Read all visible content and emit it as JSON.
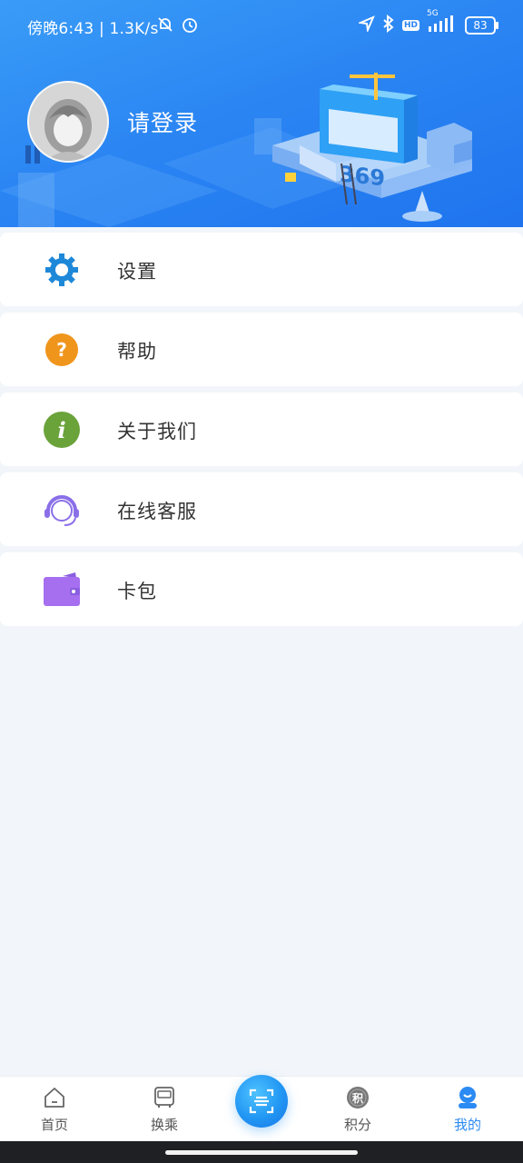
{
  "status_bar": {
    "time_text": "傍晚6:43",
    "speed_text": "1.3K/s",
    "network": "5G",
    "hd_label": "HD",
    "battery": "83"
  },
  "profile": {
    "login_text": "请登录",
    "banner_number": "369"
  },
  "menu": {
    "items": [
      {
        "label": "设置",
        "icon": "gear-icon",
        "color": "#1e88d8"
      },
      {
        "label": "帮助",
        "icon": "help-icon",
        "color": "#f0951c"
      },
      {
        "label": "关于我们",
        "icon": "info-icon",
        "color": "#6aa33a"
      },
      {
        "label": "在线客服",
        "icon": "headset-icon",
        "color": "#8a6fe8"
      },
      {
        "label": "卡包",
        "icon": "wallet-icon",
        "color": "#a66ff0"
      }
    ]
  },
  "bottom_nav": {
    "items": [
      {
        "label": "首页",
        "icon": "home-icon"
      },
      {
        "label": "换乘",
        "icon": "bus-icon"
      },
      {
        "label": "积分",
        "icon": "points-icon",
        "badge": "积"
      },
      {
        "label": "我的",
        "icon": "profile-icon",
        "active": true
      }
    ],
    "scan_icon": "scan-icon"
  },
  "colors": {
    "header_blue": "#2b86f3",
    "active_nav": "#2b8af3",
    "background": "#f2f6fa"
  }
}
